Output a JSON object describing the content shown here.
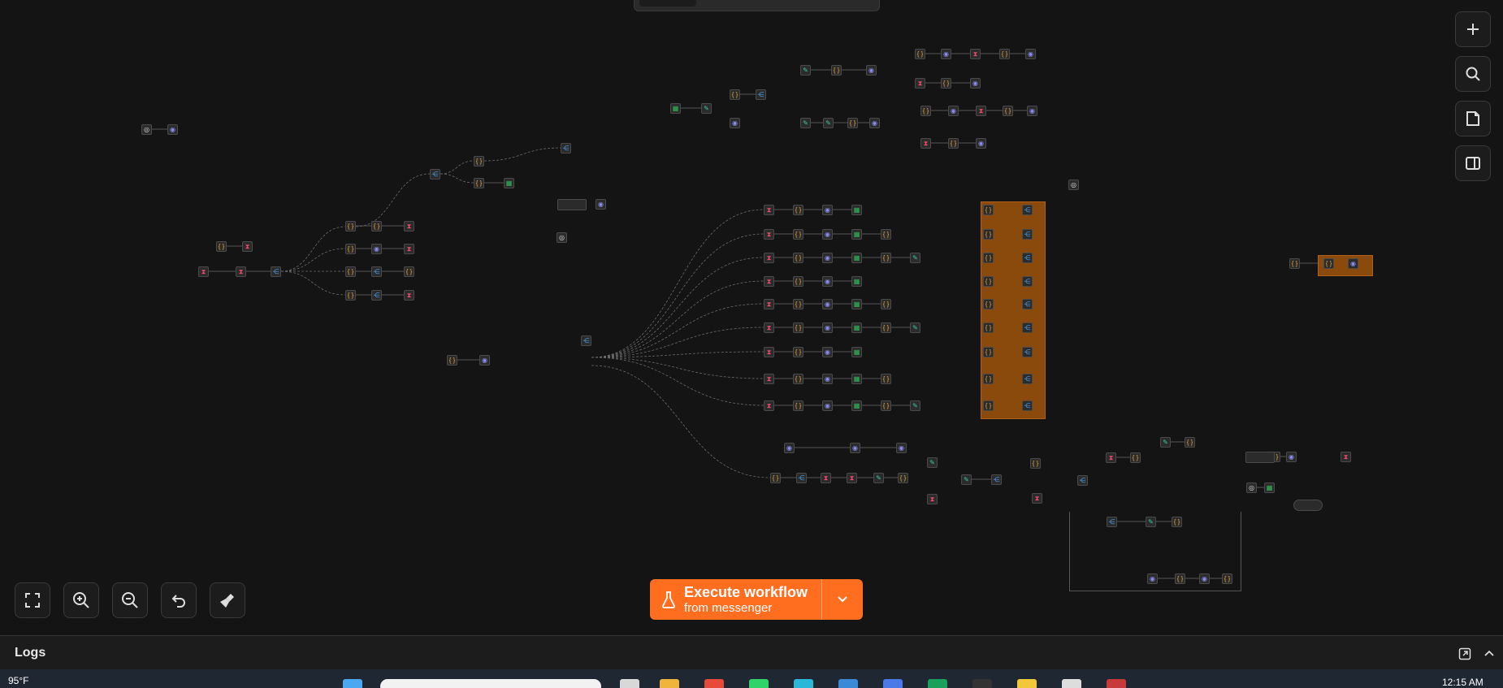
{
  "app": {
    "execute_label": "Execute workflow",
    "execute_sublabel": "from messenger",
    "logs_title": "Logs"
  },
  "icons": {
    "add": "plus-icon",
    "search": "search-icon",
    "sticky": "sticky-note-icon",
    "panel": "side-panel-icon",
    "fit": "fit-view-icon",
    "zoom_in": "zoom-in-icon",
    "zoom_out": "zoom-out-icon",
    "undo": "undo-icon",
    "tidy": "broom-icon",
    "flask": "flask-icon",
    "chevron": "chevron-down-icon",
    "popout": "popout-icon",
    "collapse": "chevron-up-icon"
  },
  "colors": {
    "accent": "#ff6d1f",
    "canvas_bg": "#141414",
    "sticky_orange": "#8a4a0c"
  },
  "taskbar": {
    "temperature": "95°F",
    "time": "12:15 AM"
  }
}
